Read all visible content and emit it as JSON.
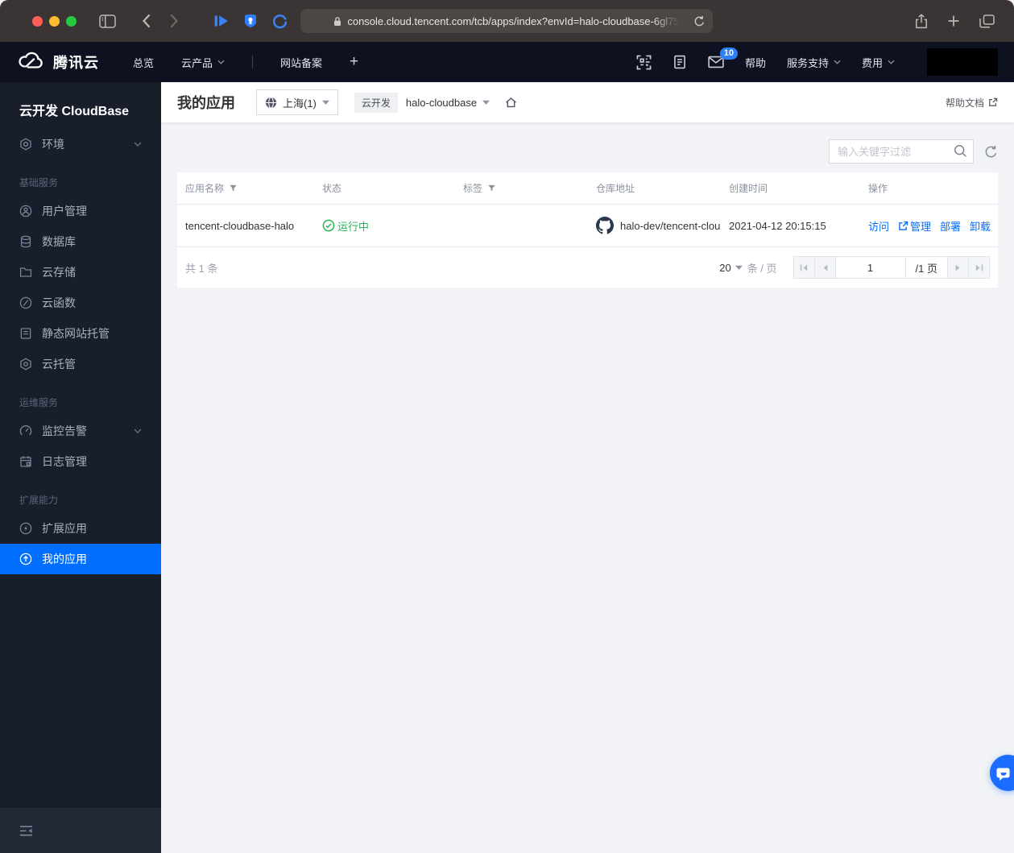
{
  "browser": {
    "url": "console.cloud.tencent.com/tcb/apps/index?envId=halo-cloudbase-6gl75"
  },
  "topnav": {
    "brand": "腾讯云",
    "overview": "总览",
    "products": "云产品",
    "icp": "网站备案",
    "new_tab": "+",
    "mail_badge": "10",
    "help": "帮助",
    "support": "服务支持",
    "billing": "费用"
  },
  "sidebar": {
    "title": "云开发 CloudBase",
    "env": "环境",
    "groups": [
      {
        "heading": "基础服务",
        "items": [
          {
            "label": "用户管理"
          },
          {
            "label": "数据库"
          },
          {
            "label": "云存储"
          },
          {
            "label": "云函数"
          },
          {
            "label": "静态网站托管"
          },
          {
            "label": "云托管"
          }
        ]
      },
      {
        "heading": "运维服务",
        "items": [
          {
            "label": "监控告警"
          },
          {
            "label": "日志管理"
          }
        ]
      },
      {
        "heading": "扩展能力",
        "items": [
          {
            "label": "扩展应用"
          },
          {
            "label": "我的应用"
          }
        ]
      }
    ]
  },
  "header": {
    "title": "我的应用",
    "region": "上海(1)",
    "service_tag": "云开发",
    "env_name": "halo-cloudbase",
    "help_doc": "帮助文档"
  },
  "toolbar": {
    "search_placeholder": "输入关键字过滤"
  },
  "table": {
    "columns": [
      "应用名称",
      "状态",
      "标签",
      "仓库地址",
      "创建时间",
      "操作"
    ],
    "rows": [
      {
        "name": "tencent-cloudbase-halo",
        "status": "运行中",
        "tags": "",
        "repo": "halo-dev/tencent-clou",
        "created": "2021-04-12 20:15:15",
        "actions": [
          "访问",
          "管理",
          "部署",
          "卸载"
        ]
      }
    ]
  },
  "pagination": {
    "total": "共 1 条",
    "page_size": "20",
    "unit": "条 / 页",
    "current_page": "1",
    "page_count": "/1 页"
  },
  "colors": {
    "accent": "#006eff",
    "status_running_green": "#2bb35a",
    "topnav_bg": "#0e1220",
    "sidebar_bg": "#191e2b"
  }
}
